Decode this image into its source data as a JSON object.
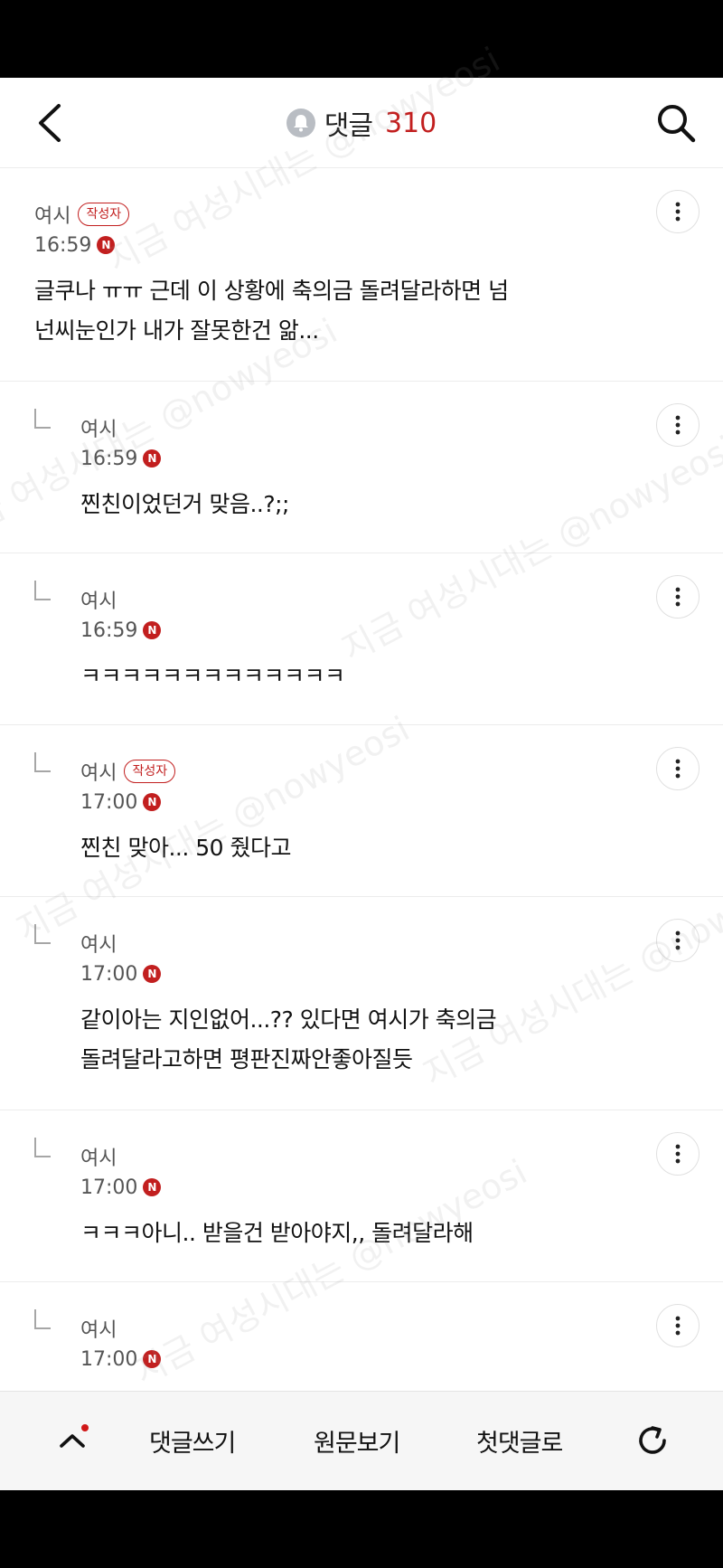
{
  "header": {
    "title": "댓글",
    "count": "310"
  },
  "comments": [
    {
      "author": "여시",
      "writer_badge": "작성자",
      "time": "16:59",
      "new_badge": "N",
      "text_lines": [
        "글쿠나 ㅠㅠ 근데 이 상황에 축의금 돌려달라하면 넘",
        "넌씨눈인가 내가 잘못한건 앎..."
      ]
    },
    {
      "author": "여시",
      "time": "16:59",
      "new_badge": "N",
      "text_lines": [
        "찐친이었던거 맞음..?;;"
      ]
    },
    {
      "author": "여시",
      "time": "16:59",
      "new_badge": "N",
      "text_lines": [
        "ㅋㅋㅋㅋㅋㅋㅋㅋㅋㅋㅋㅋㅋ"
      ]
    },
    {
      "author": "여시",
      "writer_badge": "작성자",
      "time": "17:00",
      "new_badge": "N",
      "text_lines": [
        "찐친 맞아... 50 줬다고"
      ]
    },
    {
      "author": "여시",
      "time": "17:00",
      "new_badge": "N",
      "text_lines": [
        "같이아는 지인없어...?? 있다면 여시가 축의금",
        "돌려달라고하면 평판진짜안좋아질듯"
      ]
    },
    {
      "author": "여시",
      "time": "17:00",
      "new_badge": "N",
      "text_lines": [
        "ㅋㅋㅋ아니.. 받을건 받아야지,, 돌려달라해"
      ]
    },
    {
      "author": "여시",
      "time": "17:00",
      "new_badge": "N",
      "text_lines": []
    }
  ],
  "bottom_bar": {
    "write_label": "댓글쓰기",
    "original_label": "원문보기",
    "first_label": "첫댓글로"
  },
  "watermark": {
    "text_a": "지금 여성시대는 @nowyeosi"
  },
  "colors": {
    "accent": "#c21f1f",
    "divider": "#ececec",
    "bottom_bar_bg": "#f6f6f6"
  }
}
